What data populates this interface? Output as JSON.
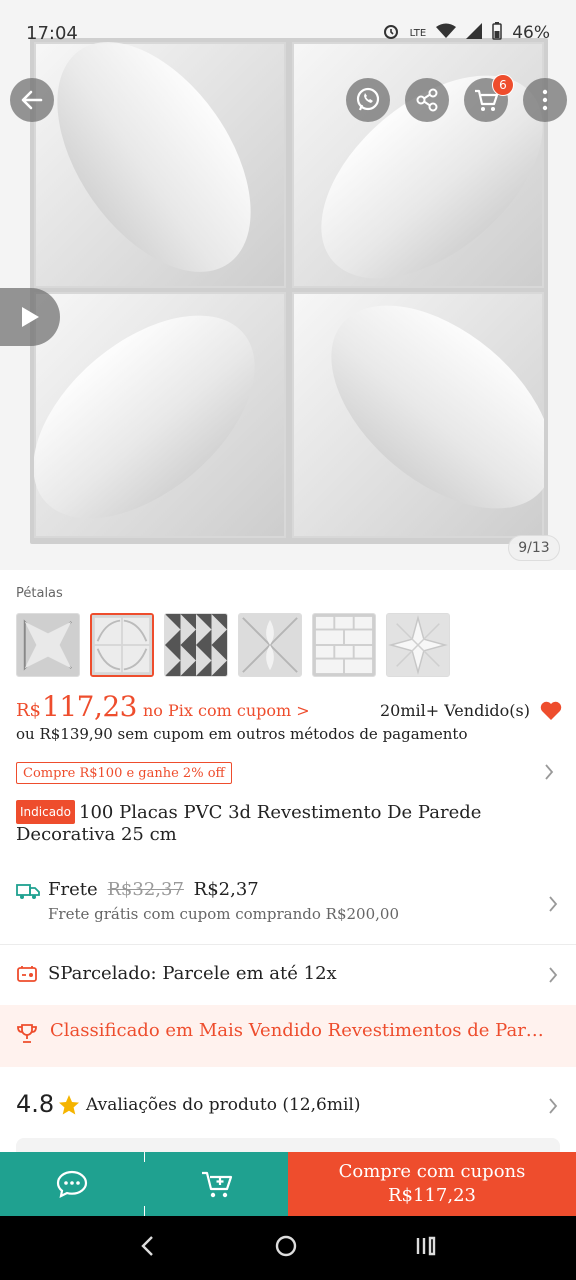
{
  "status_bar": {
    "time": "17:04",
    "battery": "46%",
    "network": "LTE"
  },
  "gallery": {
    "counter": "9/13"
  },
  "header": {
    "cart_count": "6"
  },
  "variation": {
    "label": "Pétalas",
    "options": [
      "diamond",
      "petals",
      "triangles",
      "flower-cross",
      "bricks",
      "star-flower"
    ],
    "selected_index": 1
  },
  "price": {
    "currency": "R$",
    "amount": "117,23",
    "pix_text": "no Pix com cupom >",
    "sold_text": "20mil+ Vendido(s)",
    "alt_text": "ou R$139,90 sem cupom em outros métodos de pagamento"
  },
  "coupon": {
    "label": "Compre R$100 e ganhe 2% off"
  },
  "product": {
    "tag": "Indicado",
    "title": "100 Placas PVC 3d Revestimento De Parede Decorativa 25 cm"
  },
  "shipping": {
    "label": "Frete",
    "old_price": "R$32,37",
    "new_price": "R$2,37",
    "note": "Frete grátis com cupom comprando R$200,00"
  },
  "installments": {
    "label": "SParcelado: Parcele em até 12x"
  },
  "ranking": {
    "label": "Classificado em Mais Vendido Revestimentos de Pared..."
  },
  "rating": {
    "score": "4.8",
    "label": "Avaliações do produto (12,6mil)"
  },
  "actions": {
    "buy_line1": "Compre com cupons",
    "buy_line2": "R$117,23"
  },
  "colors": {
    "accent": "#ee4d2d",
    "teal": "#1fa190"
  }
}
